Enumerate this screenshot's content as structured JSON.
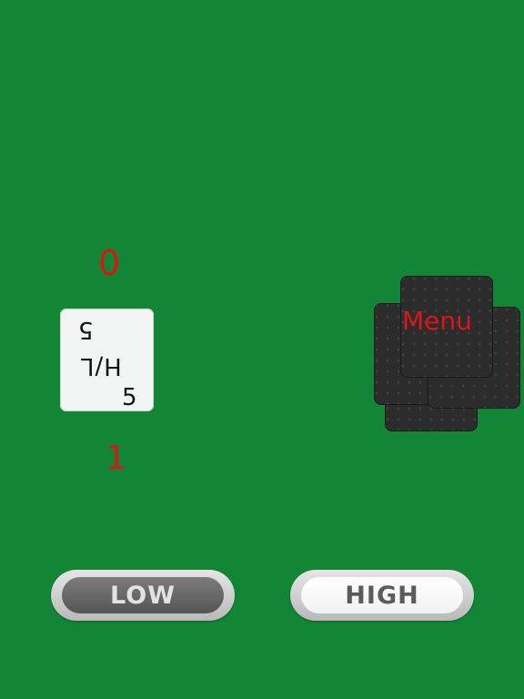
{
  "scores": {
    "top": "0",
    "bottom": "1"
  },
  "current_card": {
    "value": "5",
    "center_label": "H/L"
  },
  "deck": {
    "menu_label": "Menu"
  },
  "buttons": {
    "low_label": "LOW",
    "high_label": "HIGH"
  },
  "colors": {
    "table": "#138536",
    "score_red": "#d81717"
  }
}
